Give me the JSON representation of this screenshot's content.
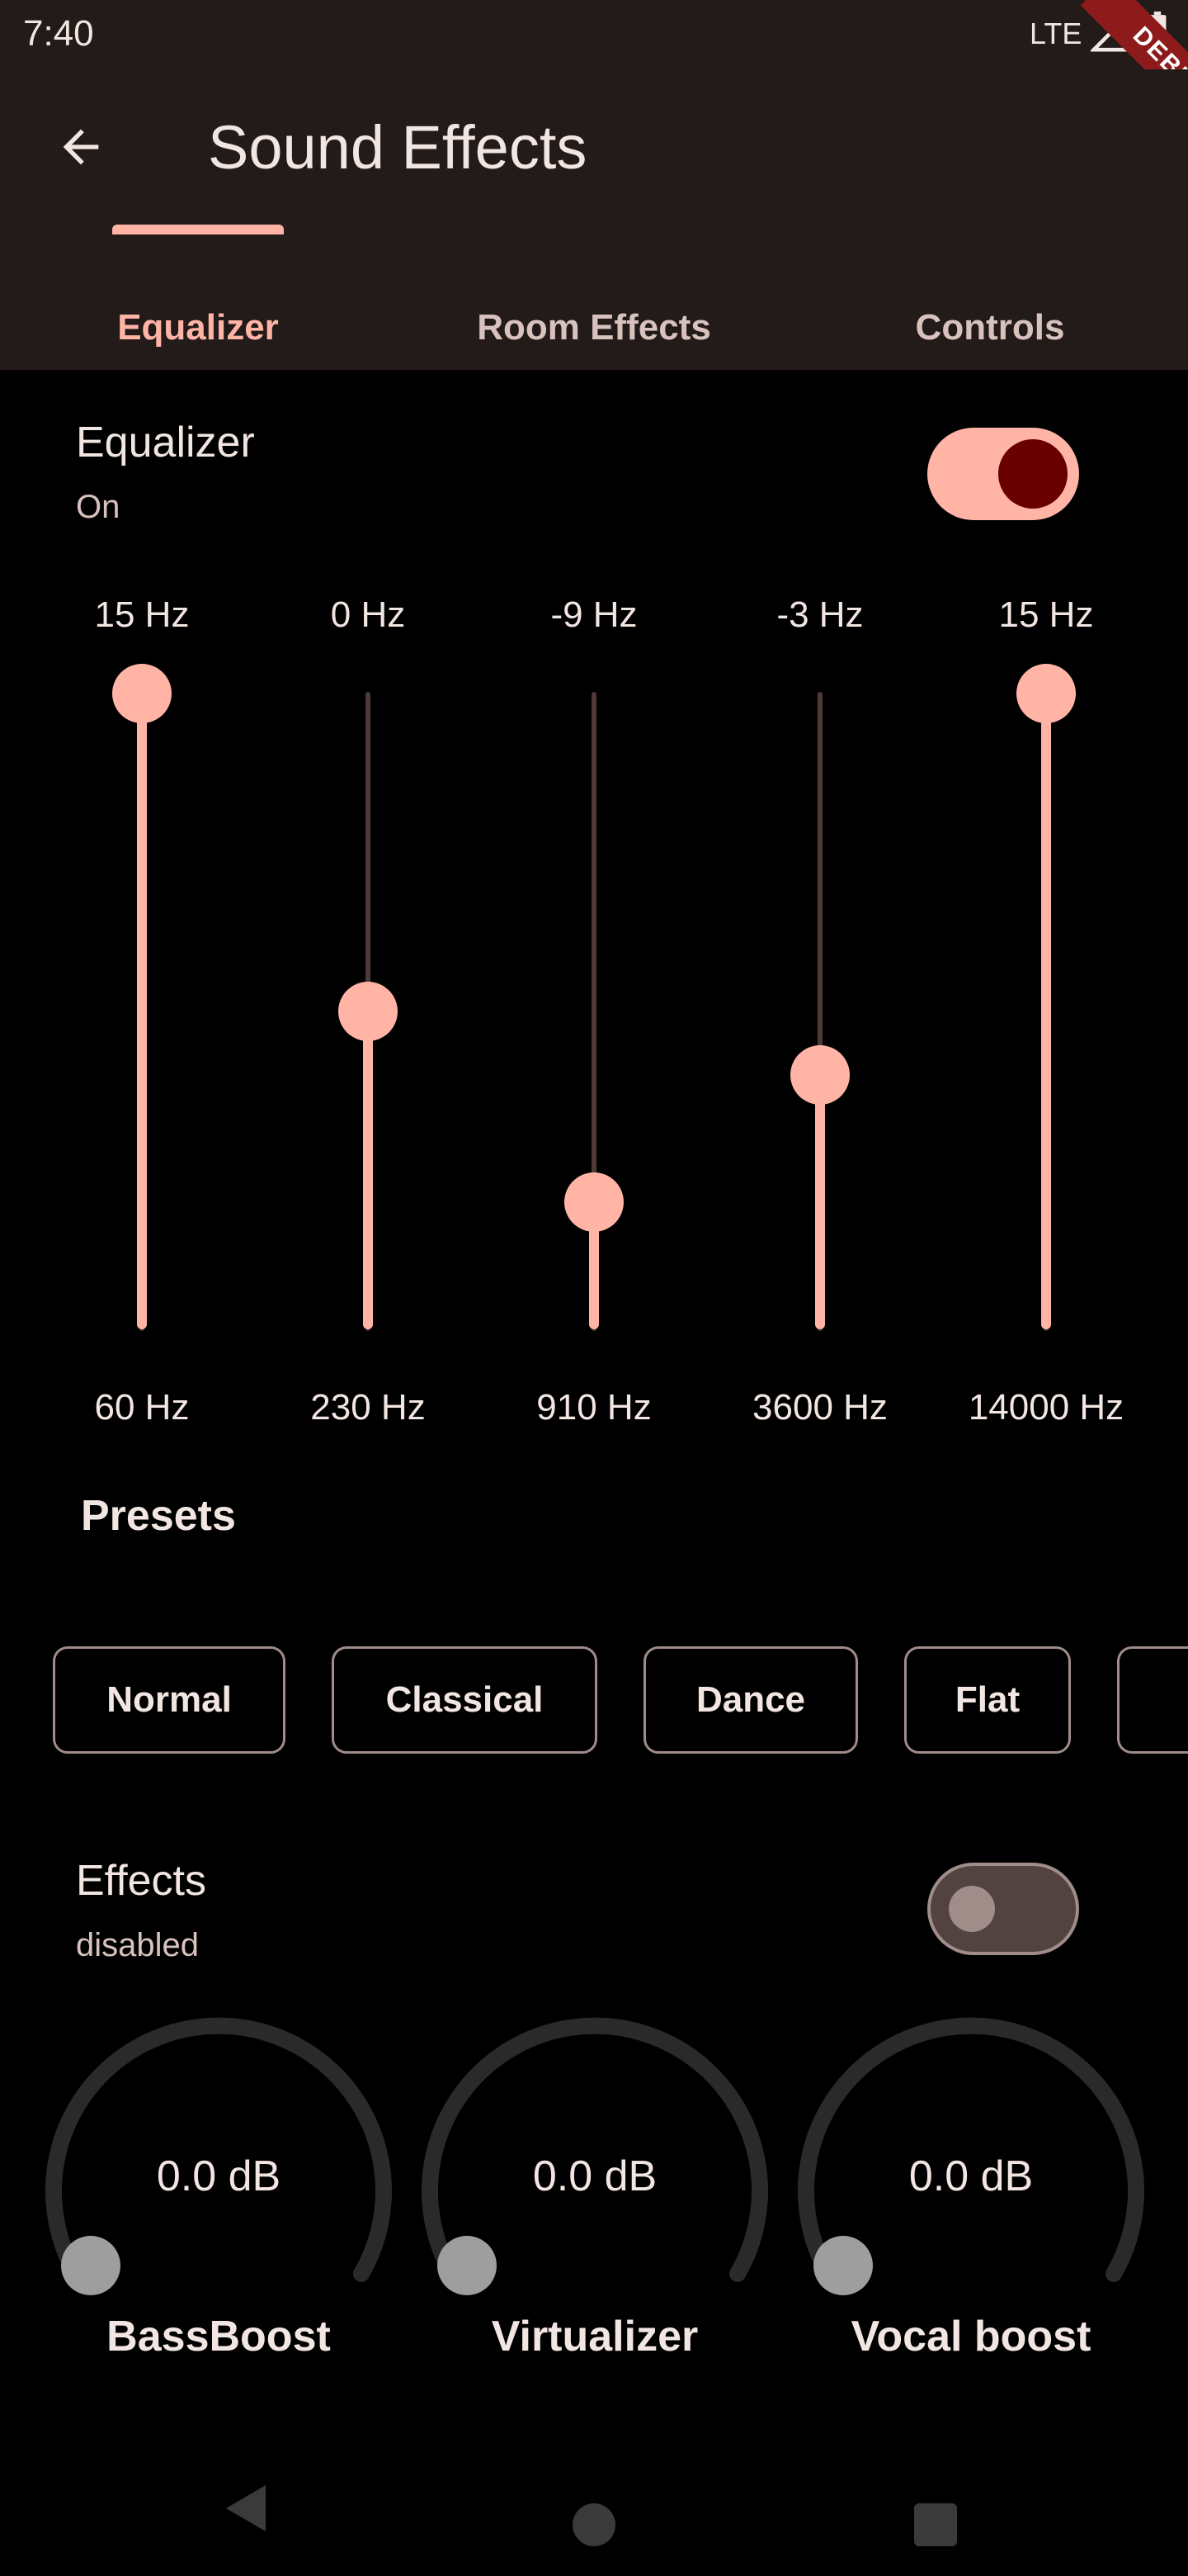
{
  "status": {
    "time": "7:40",
    "network": "LTE",
    "debug_label": "DEBUG"
  },
  "app_bar": {
    "title": "Sound Effects",
    "back_icon": "arrow-left-icon"
  },
  "tabs": [
    {
      "label": "Equalizer",
      "active": true
    },
    {
      "label": "Room Effects",
      "active": false
    },
    {
      "label": "Controls",
      "active": false
    }
  ],
  "equalizer": {
    "title": "Equalizer",
    "status": "On",
    "enabled": true,
    "bands": [
      {
        "value_label": "15 Hz",
        "freq_label": "60 Hz",
        "level": 15
      },
      {
        "value_label": "0 Hz",
        "freq_label": "230 Hz",
        "level": 0
      },
      {
        "value_label": "-9 Hz",
        "freq_label": "910 Hz",
        "level": -9
      },
      {
        "value_label": "-3 Hz",
        "freq_label": "3600 Hz",
        "level": -3
      },
      {
        "value_label": "15 Hz",
        "freq_label": "14000 Hz",
        "level": 15
      }
    ],
    "range": [
      -15,
      15
    ]
  },
  "presets": {
    "title": "Presets",
    "items": [
      "Normal",
      "Classical",
      "Dance",
      "Flat"
    ]
  },
  "effects": {
    "title": "Effects",
    "status": "disabled",
    "enabled": false,
    "knobs": [
      {
        "value": "0.0 dB",
        "label": "BassBoost"
      },
      {
        "value": "0.0 dB",
        "label": "Virtualizer"
      },
      {
        "value": "0.0 dB",
        "label": "Vocal boost"
      }
    ]
  },
  "colors": {
    "accent": "#ffb4a6",
    "app_bar_bg": "#221b19",
    "switch_thumb_on": "#690000",
    "debug_ribbon": "#8e1b1b"
  }
}
